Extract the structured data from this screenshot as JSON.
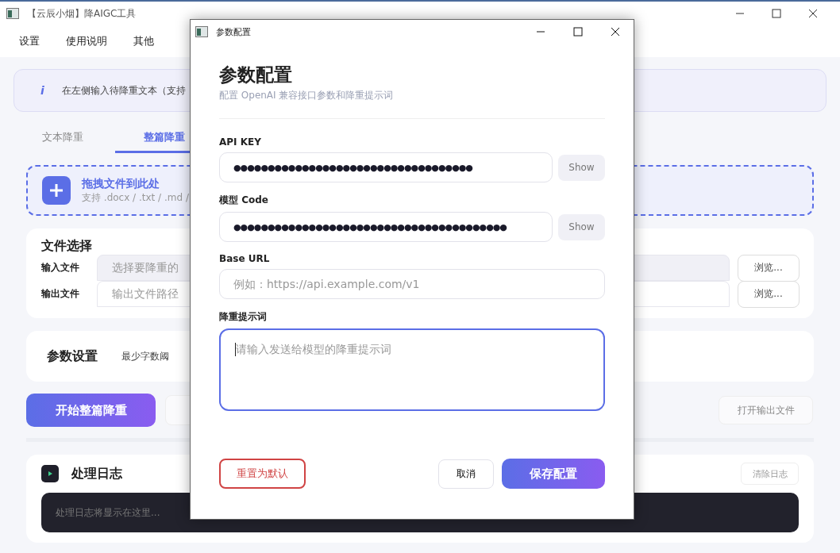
{
  "window": {
    "title": "【云辰小烟】降AIGC工具"
  },
  "menu": [
    "设置",
    "使用说明",
    "其他"
  ],
  "info": {
    "icon": "i",
    "text": "在左侧输入待降重文本（支持"
  },
  "tabs": [
    {
      "label": "文本降重",
      "selected": false
    },
    {
      "label": "整篇降重",
      "selected": true
    }
  ],
  "dropzone": {
    "title": "拖拽文件到此处",
    "hint": "支持 .docx / .txt / .md /"
  },
  "files": {
    "title": "文件选择",
    "rows": [
      {
        "label": "输入文件",
        "placeholder": "选择要降重的",
        "disabled": true,
        "button": "浏览..."
      },
      {
        "label": "输出文件",
        "placeholder": "输出文件路径",
        "disabled": false,
        "button": "浏览..."
      }
    ]
  },
  "params": {
    "title": "参数设置",
    "label": "最少字数阈"
  },
  "actions": {
    "start": "开始整篇降重",
    "open": "打开输出文件"
  },
  "log": {
    "title": "处理日志",
    "clear": "清除日志",
    "placeholder": "处理日志将显示在这里..."
  },
  "dialog": {
    "title": "参数配置",
    "heading": "参数配置",
    "subtitle": "配置 OpenAI 兼容接口参数和降重提示词",
    "fields": [
      {
        "kind": "secret",
        "label": "API KEY",
        "value": "●●●●●●●●●●●●●●●●●●●●●●●●●●●●●●●●●●●",
        "button": "Show"
      },
      {
        "kind": "secret",
        "label": "模型 Code",
        "value": "●●●●●●●●●●●●●●●●●●●●●●●●●●●●●●●●●●●●●●●●",
        "button": "Show"
      },
      {
        "kind": "text",
        "label": "Base URL",
        "placeholder": "例如：https://api.example.com/v1"
      },
      {
        "kind": "textarea",
        "label": "降重提示词",
        "placeholder": "请输入发送给模型的降重提示词",
        "focused": true
      }
    ],
    "reset": "重置为默认",
    "cancel": "取消",
    "save": "保存配置"
  }
}
